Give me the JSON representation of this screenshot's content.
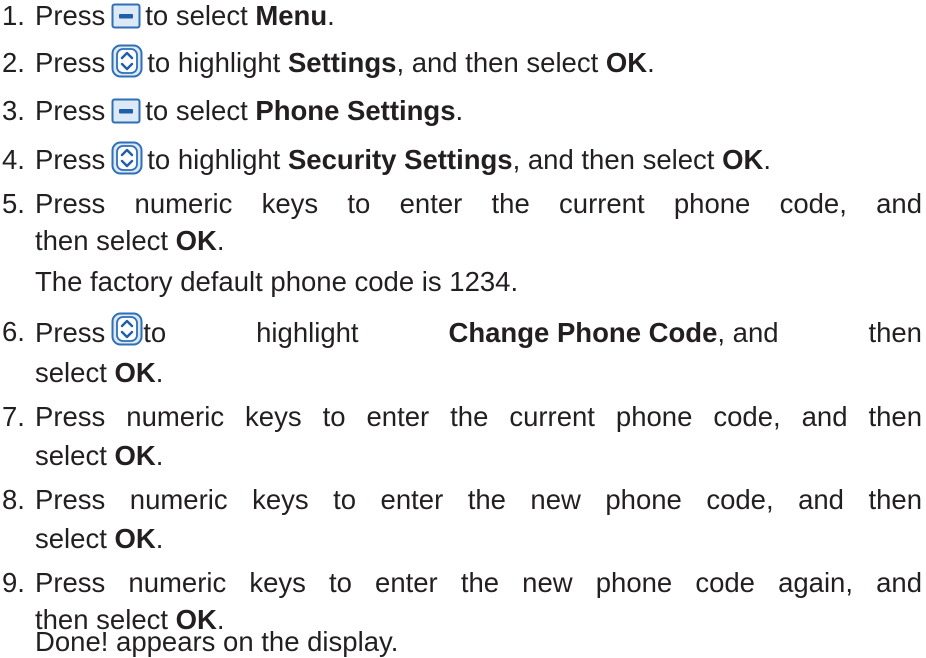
{
  "steps": [
    {
      "number": "1.",
      "line1": {
        "pre": "Press",
        "icon": "soft-key-minus-icon",
        "mid": "to select ",
        "bold": "Menu",
        "post": "."
      }
    },
    {
      "number": "2.",
      "line1": {
        "pre": "Press",
        "icon": "nav-key-updown-icon",
        "mid": "to highlight ",
        "bold": "Settings",
        "mid2": ", and then select ",
        "bold2": "OK",
        "post": "."
      }
    },
    {
      "number": "3.",
      "line1": {
        "pre": "Press",
        "icon": "soft-key-minus-icon",
        "mid": "to select ",
        "bold": "Phone Settings",
        "post": "."
      }
    },
    {
      "number": "4.",
      "line1": {
        "pre": "Press",
        "icon": "nav-key-updown-icon",
        "mid": "to highlight ",
        "bold": "Security Settings",
        "mid2": ", and then select ",
        "bold2": "OK",
        "post": "."
      }
    },
    {
      "number": "5.",
      "line1_text": "Press numeric keys to enter the current phone code, and",
      "line2_pre": "then select ",
      "line2_bold": "OK",
      "line2_post": ".",
      "note": "The factory default phone code is 1234."
    },
    {
      "number": "6.",
      "line1": {
        "pre": "Press",
        "icon": "nav-key-updown-icon",
        "a": "to",
        "b": "highlight",
        "bold": "Change Phone Code",
        "c": ", and",
        "d": "then"
      },
      "line2_pre": "select ",
      "line2_bold": "OK",
      "line2_post": "."
    },
    {
      "number": "7.",
      "line1_text": "Press numeric keys to enter the current phone code, and then",
      "line2_pre": "select ",
      "line2_bold": "OK",
      "line2_post": "."
    },
    {
      "number": "8.",
      "line1_text": "Press numeric keys to enter the new phone code, and then",
      "line2_pre": "select ",
      "line2_bold": "OK",
      "line2_post": "."
    },
    {
      "number": "9.",
      "line1_text": "Press numeric keys to enter the new phone code again, and",
      "line2_pre": "then select ",
      "line2_bold": "OK",
      "line2_post": ".",
      "note": "Done! appears on the display."
    }
  ],
  "colors": {
    "text": "#231f20",
    "icon_border": "#2f6fb6",
    "icon_fill": "#dce9f7",
    "icon_mark": "#1f5fa8"
  }
}
